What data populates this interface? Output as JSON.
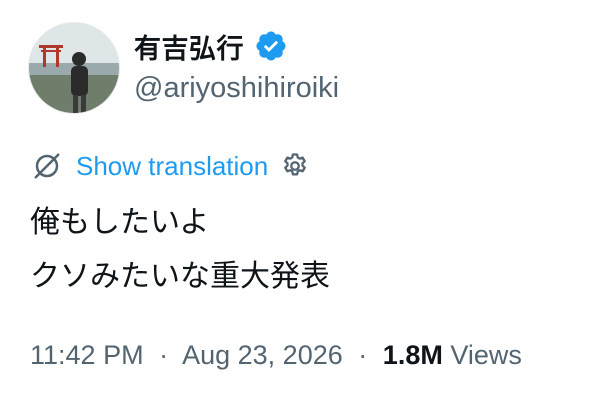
{
  "user": {
    "display_name": "有吉弘行",
    "handle": "@ariyoshihiroiki",
    "verified": true
  },
  "translation": {
    "link_label": "Show translation"
  },
  "tweet": {
    "lines": [
      "俺もしたいよ",
      "クソみたいな重大発表"
    ]
  },
  "meta": {
    "time": "11:42 PM",
    "date": "Aug 23, 2026",
    "separator": "·",
    "views_count": "1.8M",
    "views_label": "Views"
  },
  "colors": {
    "link": "#1d9bf0",
    "muted": "#536471",
    "text": "#0f1419",
    "verified_badge": "#1d9bf0"
  },
  "icons": {
    "verified": "verified-badge-icon",
    "translate": "globe-slash-icon",
    "settings": "gear-icon"
  }
}
